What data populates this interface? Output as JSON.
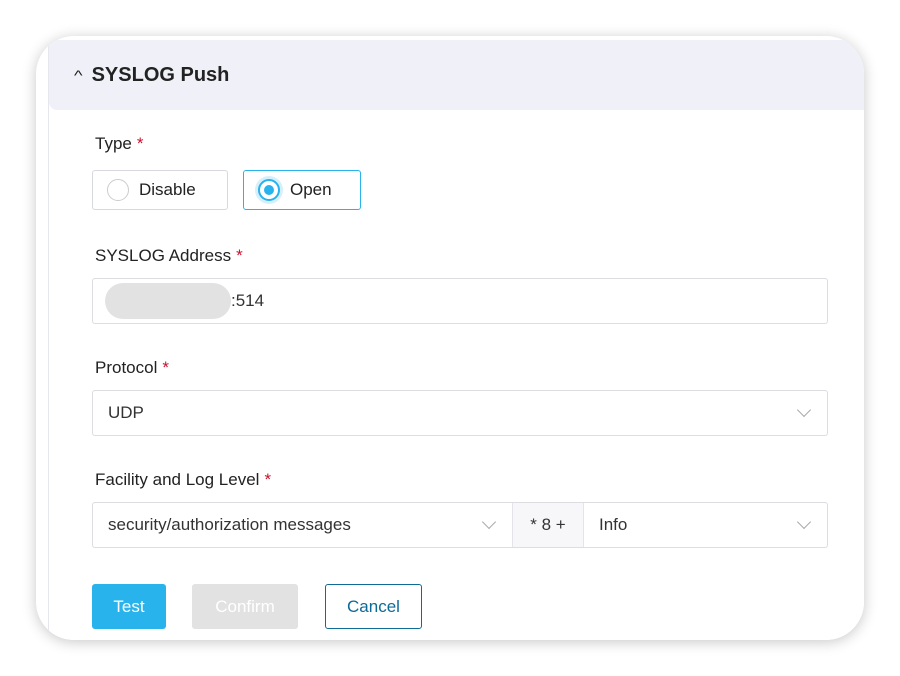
{
  "section": {
    "title": "SYSLOG Push",
    "collapse_icon": "chevron-up-icon"
  },
  "type": {
    "label": "Type",
    "required": "*",
    "options": [
      {
        "label": "Disable",
        "selected": false
      },
      {
        "label": "Open",
        "selected": true
      }
    ]
  },
  "address": {
    "label": "SYSLOG Address",
    "required": "*",
    "value_suffix": ":514"
  },
  "protocol": {
    "label": "Protocol",
    "required": "*",
    "value": "UDP"
  },
  "facility": {
    "label": "Facility and Log Level",
    "required": "*",
    "facility_value": "security/authorization messages",
    "separator": "* 8 +",
    "level_value": "Info"
  },
  "buttons": {
    "test": "Test",
    "confirm": "Confirm",
    "cancel": "Cancel"
  },
  "colors": {
    "accent": "#29b3ec",
    "cancel": "#0e6a96",
    "required": "#c8102e"
  }
}
